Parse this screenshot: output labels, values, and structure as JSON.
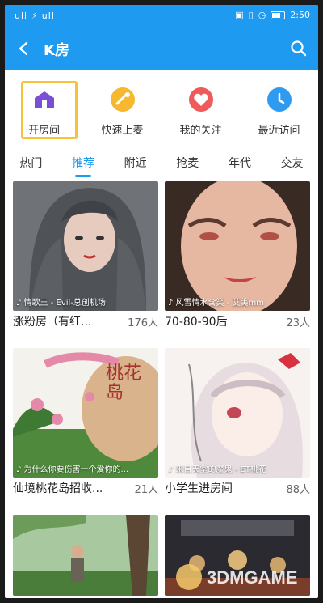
{
  "status": {
    "left": "ull ⚡ ull",
    "time": "2:50"
  },
  "header": {
    "title": "K房"
  },
  "quick_actions": [
    {
      "label": "开房间",
      "icon": "house-icon"
    },
    {
      "label": "快速上麦",
      "icon": "mic-icon"
    },
    {
      "label": "我的关注",
      "icon": "heart-icon"
    },
    {
      "label": "最近访问",
      "icon": "clock-icon"
    }
  ],
  "tabs": [
    "热门",
    "推荐",
    "附近",
    "抢麦",
    "年代",
    "交友"
  ],
  "active_tab": "推荐",
  "rooms": [
    {
      "caption": "♪ 情歌王 - Evil-总创机场",
      "name": "涨粉房（有红...",
      "count": "176人"
    },
    {
      "caption": "♪ 风雪情水含笑 - 艾美mm",
      "name": "70-80-90后",
      "count": "23人"
    },
    {
      "caption": "♪ 为什么你要伤害一个爱你的...",
      "name": "仙境桃花岛招收...",
      "count": "21人"
    },
    {
      "caption": "♪ 来自天堂的魔鬼 - ET桃花",
      "name": "小学生进房间",
      "count": "88人"
    }
  ],
  "thumb_text": {
    "peach_island": "桃花岛"
  },
  "watermark": {
    "text": "3DMGAME"
  }
}
